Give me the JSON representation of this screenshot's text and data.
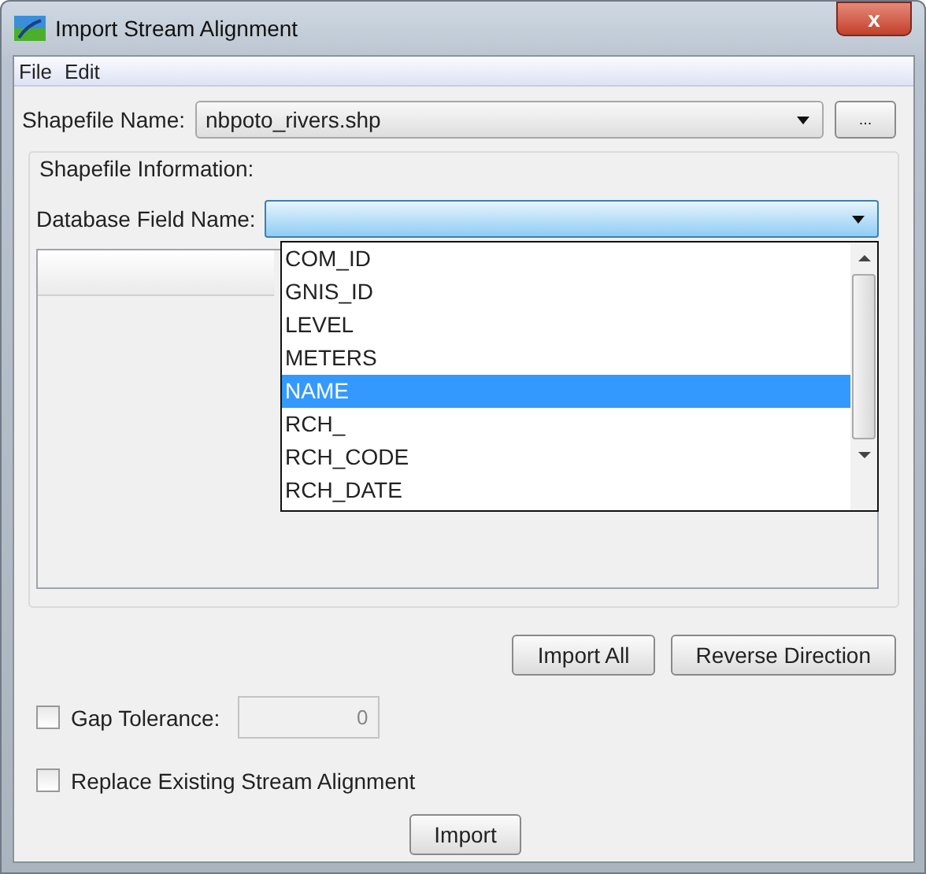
{
  "window": {
    "title": "Import Stream Alignment",
    "close_label": "x"
  },
  "menu": [
    {
      "label": "File"
    },
    {
      "label": "Edit"
    }
  ],
  "shapefile": {
    "label": "Shapefile Name:",
    "value": "nbpoto_rivers.shp",
    "browse_label": "..."
  },
  "shapefile_information": {
    "title": "Shapefile Information:",
    "field_label": "Database Field Name:",
    "dropdown": {
      "expanded": true,
      "items": [
        {
          "label": "COM_ID",
          "selected": false
        },
        {
          "label": "GNIS_ID",
          "selected": false
        },
        {
          "label": "LEVEL",
          "selected": false
        },
        {
          "label": "METERS",
          "selected": false
        },
        {
          "label": "NAME",
          "selected": true
        },
        {
          "label": "RCH_",
          "selected": false
        },
        {
          "label": "RCH_CODE",
          "selected": false
        },
        {
          "label": "RCH_DATE",
          "selected": false
        }
      ]
    }
  },
  "buttons": [
    {
      "label": "Import All"
    },
    {
      "label": "Reverse Direction"
    }
  ],
  "gap_tolerance": {
    "label": "Gap Tolerance:",
    "checked": false,
    "value": "0"
  },
  "replace": {
    "label": "Replace Existing Stream Alignment",
    "checked": false
  },
  "import_button": {
    "label": "Import"
  }
}
